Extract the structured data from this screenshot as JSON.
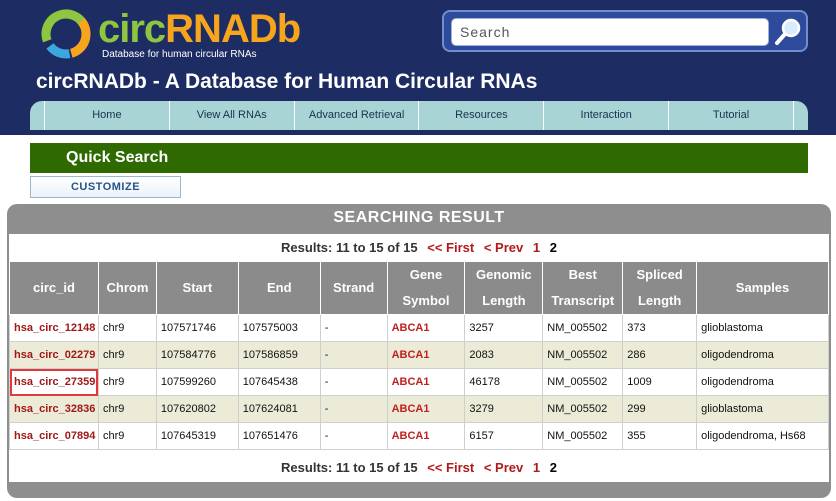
{
  "logo": {
    "text_a": "circ",
    "text_b": "RNADb",
    "tagline": "Database for human circular RNAs"
  },
  "search": {
    "placeholder": "Search"
  },
  "site_title": "circRNADb - A Database for Human Circular RNAs",
  "nav": [
    "Home",
    "View All RNAs",
    "Advanced Retrieval",
    "Resources",
    "Interaction",
    "Tutorial"
  ],
  "quick_search": {
    "title": "Quick Search",
    "customize": "CUSTOMIZE"
  },
  "results": {
    "title": "SEARCHING RESULT",
    "pager": {
      "summary": "Results: 11 to 15 of 15",
      "first": "<< First",
      "prev": "< Prev",
      "page1": "1",
      "page2": "2"
    },
    "columns": [
      "circ_id",
      "Chrom",
      "Start",
      "End",
      "Strand",
      "Gene Symbol",
      "Genomic Length",
      "Best Transcript",
      "Spliced Length",
      "Samples"
    ],
    "rows": [
      [
        "hsa_circ_12148",
        "chr9",
        "107571746",
        "107575003",
        "-",
        "ABCA1",
        "3257",
        "NM_005502",
        "373",
        "glioblastoma"
      ],
      [
        "hsa_circ_02279",
        "chr9",
        "107584776",
        "107586859",
        "-",
        "ABCA1",
        "2083",
        "NM_005502",
        "286",
        "oligodendroma"
      ],
      [
        "hsa_circ_27359",
        "chr9",
        "107599260",
        "107645438",
        "-",
        "ABCA1",
        "46178",
        "NM_005502",
        "1009",
        "oligodendroma"
      ],
      [
        "hsa_circ_32836",
        "chr9",
        "107620802",
        "107624081",
        "-",
        "ABCA1",
        "3279",
        "NM_005502",
        "299",
        "glioblastoma"
      ],
      [
        "hsa_circ_07894",
        "chr9",
        "107645319",
        "107651476",
        "-",
        "ABCA1",
        "6157",
        "NM_005502",
        "355",
        "oligodendroma, Hs68"
      ]
    ]
  },
  "colors": {
    "header": "#1d2d63",
    "nav": "#a9d4d6",
    "quick_bar": "#2f6a00",
    "link": "#b11a1a",
    "table_header": "#8b8b8b",
    "row_alt": "#ecebd7"
  },
  "icons": {
    "search": "magnifier-icon",
    "logo": "ring-logo-icon"
  }
}
